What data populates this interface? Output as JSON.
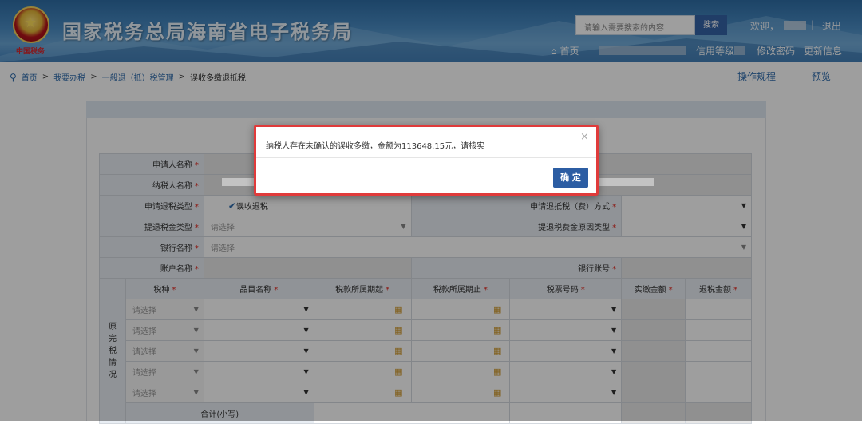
{
  "header": {
    "site_title": "国家税务总局海南省电子税务局",
    "logo_sub": "中国税务",
    "search_placeholder": "请输入需要搜索的内容",
    "search_button": "搜索",
    "welcome": "欢迎，",
    "sep": "|",
    "logout": "退出",
    "home": "首页",
    "credit": "信用等级",
    "change_password": "修改密码",
    "update_info": "更新信息",
    "home_icon": "home-icon"
  },
  "breadcrumb": {
    "items": [
      "首页",
      "我要办税",
      "一般退（抵）税管理",
      "误收多缴退抵税"
    ],
    "sep": ">",
    "pin_icon": "location-pin-icon",
    "operation_rules": "操作规程",
    "preview": "预览"
  },
  "form": {
    "applicant_name": "申请人名称",
    "taxpayer_name": "纳税人名称",
    "refund_type": "申请退税类型",
    "refund_type_value": "误收退税",
    "refund_method": "申请退抵税（费）方式",
    "refund_tax_type": "提退税金类型",
    "refund_reason_type": "提退税费金原因类型",
    "bank_name": "银行名称",
    "account_name": "账户名称",
    "bank_account": "银行账号",
    "placeholder": "请选择",
    "required": "*",
    "side_label": [
      "原",
      "完",
      "税",
      "情",
      "况"
    ],
    "columns": [
      "税种",
      "品目名称",
      "税款所属期起",
      "税款所属期止",
      "税票号码",
      "实缴金额",
      "退税金额"
    ],
    "column_required": [
      true,
      true,
      true,
      true,
      true,
      true,
      true
    ],
    "rows": [
      {
        "tax_type": "请选择"
      },
      {
        "tax_type": "请选择"
      },
      {
        "tax_type": "请选择"
      },
      {
        "tax_type": "请选择"
      },
      {
        "tax_type": "请选择"
      }
    ],
    "total_label": "合计(小写)"
  },
  "modal": {
    "message": "纳税人存在未确认的误收多缴，金额为113648.15元，请核实",
    "close": "×",
    "ok": "确 定"
  },
  "colors": {
    "header_bg": "#3d7fbd",
    "link": "#2f6cad",
    "required": "#e2261d",
    "modal_border": "#e03b3b",
    "button": "#2c5da3"
  }
}
